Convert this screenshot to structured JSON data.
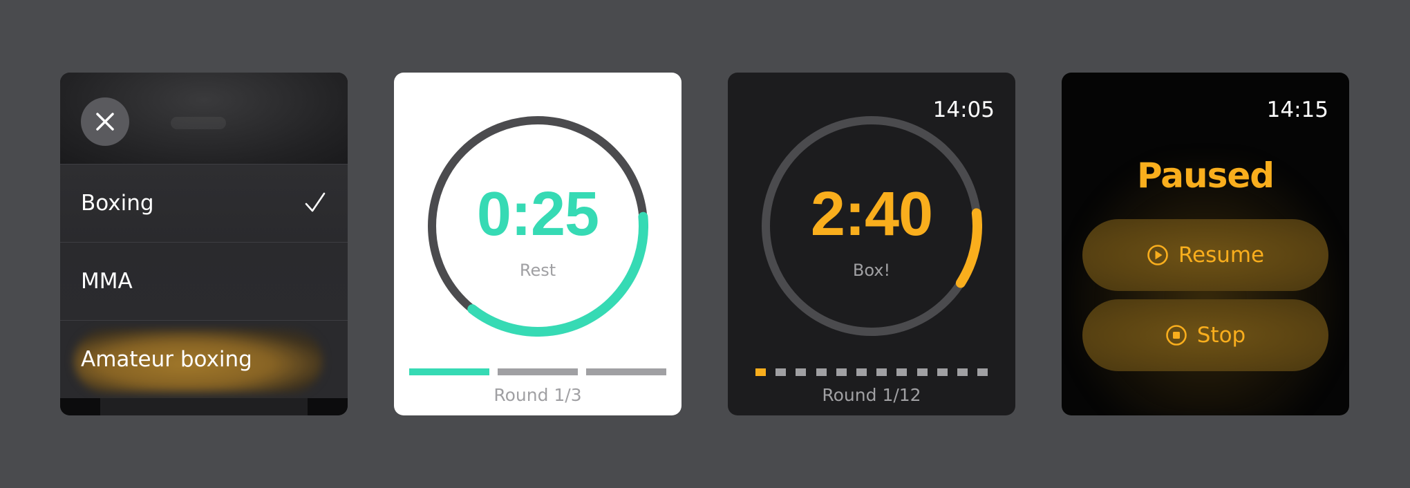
{
  "menu": {
    "close_icon": "close-icon",
    "items": [
      {
        "label": "Boxing",
        "selected": true
      },
      {
        "label": "MMA",
        "selected": false
      },
      {
        "label": "Amateur boxing",
        "selected": false
      }
    ],
    "check_icon": "checkmark-icon"
  },
  "rest_timer": {
    "time": "0:25",
    "label": "Rest",
    "round": "Round 1/3",
    "rounds_total": 3,
    "rounds_done": 1,
    "progress": 0.37,
    "accent": "#36dab4"
  },
  "box_timer": {
    "clock": "14:05",
    "time": "2:40",
    "label": "Box!",
    "round": "Round 1/12",
    "rounds_total": 12,
    "rounds_done": 1,
    "progress": 0.11,
    "accent": "#f9ae1d"
  },
  "paused": {
    "clock": "14:15",
    "title": "Paused",
    "resume_label": "Resume",
    "resume_icon": "play-circle-icon",
    "stop_label": "Stop",
    "stop_icon": "stop-circle-icon",
    "accent": "#f9ae1d"
  }
}
